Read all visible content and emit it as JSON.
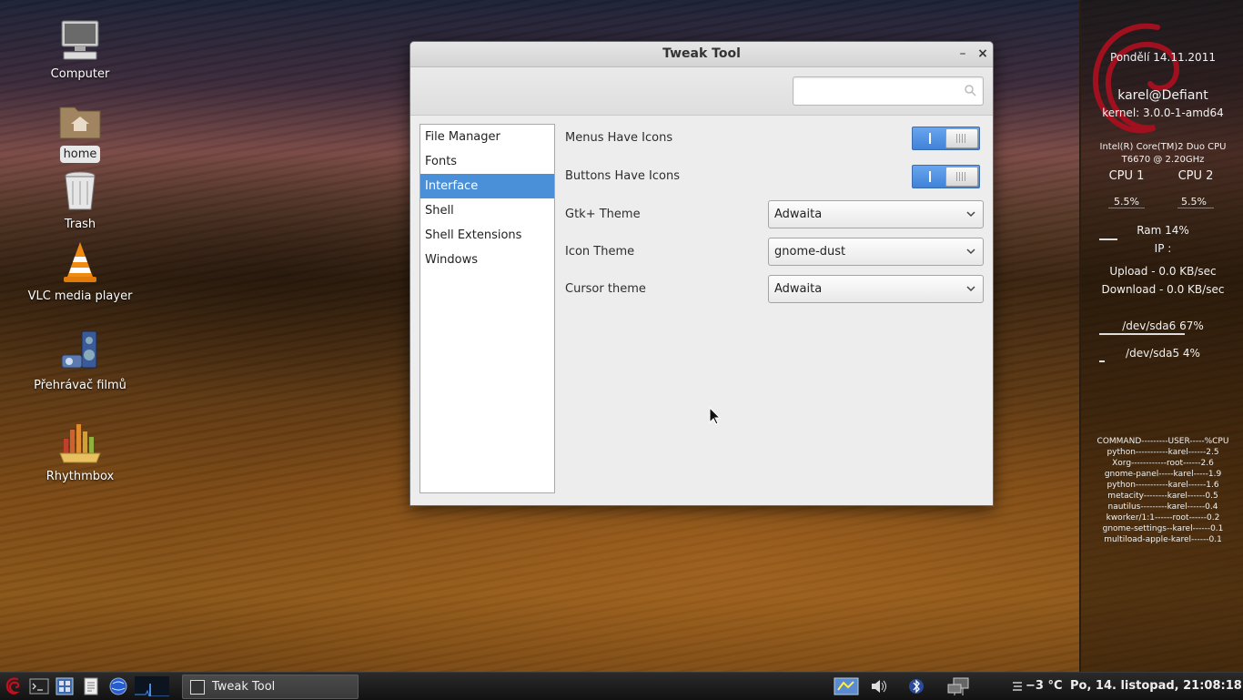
{
  "desktop": {
    "icons": [
      {
        "label": "Computer",
        "icon": "computer-icon"
      },
      {
        "label": "home",
        "icon": "home-folder-icon",
        "selected": true
      },
      {
        "label": "Trash",
        "icon": "trash-icon"
      },
      {
        "label": "VLC media player",
        "icon": "vlc-icon"
      },
      {
        "label": "Přehrávač filmů",
        "icon": "movie-player-icon"
      },
      {
        "label": "Rhythmbox",
        "icon": "rhythmbox-icon"
      }
    ]
  },
  "conky": {
    "date": "Pondělí 14.11.2011",
    "user": "karel@Defiant",
    "kernel": "kernel: 3.0.0-1-amd64",
    "cpu_model_1": "Intel(R) Core(TM)2 Duo CPU",
    "cpu_model_2": "T6670  @ 2.20GHz",
    "cpu1_label": "CPU 1",
    "cpu2_label": "CPU 2",
    "cpu1_value": "5.5%",
    "cpu2_value": "5.5%",
    "ram": "Ram 14%",
    "ram_fraction": 0.14,
    "ip": "IP :",
    "upload": "Upload - 0.0 KB/sec",
    "download": "Download - 0.0 KB/sec",
    "sda6": "/dev/sda6 67%",
    "sda6_fraction": 0.67,
    "sda5": "/dev/sda5 4%",
    "sda5_fraction": 0.04,
    "proc_header": "COMMAND---------USER-----%CPU",
    "processes": [
      "python-----------karel------2.5",
      "Xorg------------root------2.6",
      "gnome-panel-----karel-----1.9",
      "python-----------karel------1.6",
      "metacity--------karel------0.5",
      "nautilus---------karel------0.4",
      "kworker/1:1------root------0.2",
      "gnome-settings--karel------0.1",
      "multiload-apple-karel------0.1"
    ]
  },
  "window": {
    "title": "Tweak Tool",
    "minimize": "–",
    "close": "×",
    "search": {
      "value": "",
      "placeholder": ""
    },
    "sidebar": [
      {
        "label": "File Manager",
        "active": false
      },
      {
        "label": "Fonts",
        "active": false
      },
      {
        "label": "Interface",
        "active": true
      },
      {
        "label": "Shell",
        "active": false
      },
      {
        "label": "Shell Extensions",
        "active": false
      },
      {
        "label": "Windows",
        "active": false
      }
    ],
    "settings": {
      "menus_have_icons": {
        "label": "Menus Have Icons",
        "on": true
      },
      "buttons_have_icons": {
        "label": "Buttons Have Icons",
        "on": true
      },
      "gtk_theme": {
        "label": "Gtk+ Theme",
        "value": "Adwaita"
      },
      "icon_theme": {
        "label": "Icon Theme",
        "value": "gnome-dust"
      },
      "cursor_theme": {
        "label": "Cursor theme",
        "value": "Adwaita"
      }
    }
  },
  "taskbar": {
    "task_label": "Tweak Tool",
    "temperature": "−3 °C",
    "clock": "Po, 14. listopad, 21:08:18"
  },
  "colors": {
    "accent": "#4a90d9",
    "switch_on": "#3f82d8"
  }
}
